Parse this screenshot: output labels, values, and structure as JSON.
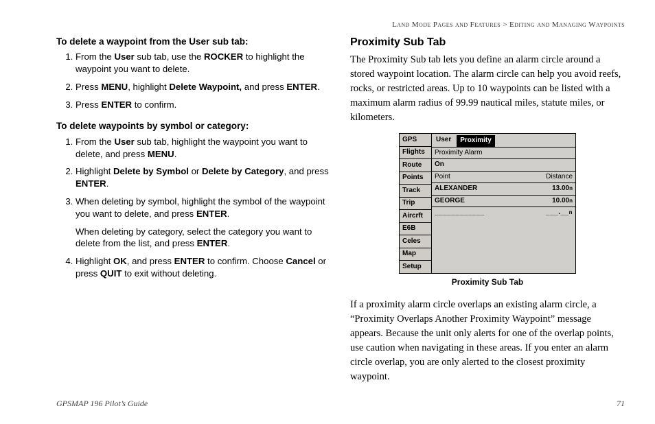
{
  "breadcrumb": {
    "section": "Land Mode Pages and Features",
    "sep": ">",
    "sub": "Editing and Managing Waypoints"
  },
  "left": {
    "sect1_title": "To delete a waypoint from the User sub tab:",
    "sect1_step1_a": "From the ",
    "sect1_step1_b_bold": "User",
    "sect1_step1_c": " sub tab, use the ",
    "sect1_step1_d_bold": "ROCKER",
    "sect1_step1_e": " to highlight the waypoint you want to delete.",
    "sect1_step2_a": "Press ",
    "sect1_step2_b_bold": "MENU",
    "sect1_step2_c": ", highlight ",
    "sect1_step2_d_bold": "Delete Waypoint,",
    "sect1_step2_e": " and press ",
    "sect1_step2_f_bold": "ENTER",
    "sect1_step2_g": ".",
    "sect1_step3_a": "Press ",
    "sect1_step3_b_bold": "ENTER",
    "sect1_step3_c": " to confirm.",
    "sect2_title": "To delete waypoints by symbol or category:",
    "sect2_step1_a": "From the ",
    "sect2_step1_b_bold": "User",
    "sect2_step1_c": " sub tab, highlight the waypoint you want to delete, and press ",
    "sect2_step1_d_bold": "MENU",
    "sect2_step1_e": ".",
    "sect2_step2_a": "Highlight ",
    "sect2_step2_b_bold": "Delete by Symbol",
    "sect2_step2_c": " or ",
    "sect2_step2_d_bold": "Delete by Category",
    "sect2_step2_e": ", and press ",
    "sect2_step2_f_bold": "ENTER",
    "sect2_step2_g": ".",
    "sect2_step3_a": "When deleting by symbol, highlight the symbol of the waypoint you want to delete, and press ",
    "sect2_step3_b_bold": "ENTER",
    "sect2_step3_c": ".",
    "sect2_step3_cont_a": "When deleting by category, select the category you want to delete from the list, and press ",
    "sect2_step3_cont_b_bold": "ENTER",
    "sect2_step3_cont_c": ".",
    "sect2_step4_a": "Highlight ",
    "sect2_step4_b_bold": "OK",
    "sect2_step4_c": ", and press ",
    "sect2_step4_d_bold": "ENTER",
    "sect2_step4_e": " to confirm. Choose ",
    "sect2_step4_f_bold": "Cancel",
    "sect2_step4_g": " or press ",
    "sect2_step4_h_bold": "QUIT",
    "sect2_step4_i": " to exit without deleting."
  },
  "right": {
    "heading": "Proximity Sub Tab",
    "para1": "The Proximity Sub tab lets you define an alarm circle around a stored waypoint location. The alarm circle can help you avoid reefs, rocks, or restricted areas. Up to 10 waypoints can be listed with a maximum alarm radius of 99.99 nautical miles, statute miles, or kilometers.",
    "caption": "Proximity Sub Tab",
    "para2": "If a proximity alarm circle overlaps an existing alarm circle, a “Proximity Overlaps Another Proximity Waypoint” message appears. Because the unit only alerts for one of the overlap points, use caution when navigating in these areas. If you enter an alarm circle overlap, you are only alerted to the closest proximity waypoint."
  },
  "screen": {
    "side_items": [
      "GPS",
      "Flights",
      "Route",
      "Points",
      "Track",
      "Trip",
      "Aircrft",
      "E6B",
      "Celes",
      "Map",
      "Setup"
    ],
    "tab_user": "User",
    "tab_proximity": "Proximity",
    "label_alarm": "Proximity Alarm",
    "value_on": "On",
    "col_point": "Point",
    "col_dist": "Distance",
    "row1_name": "ALEXANDER",
    "row1_dist": "13.00",
    "row2_name": "GEORGE",
    "row2_dist": "10.00",
    "row_blank_name": "____________",
    "row_blank_dist": "___.__",
    "unit_sup": "n"
  },
  "footer": {
    "guide": "GPSMAP 196 Pilot’s Guide",
    "page": "71"
  }
}
